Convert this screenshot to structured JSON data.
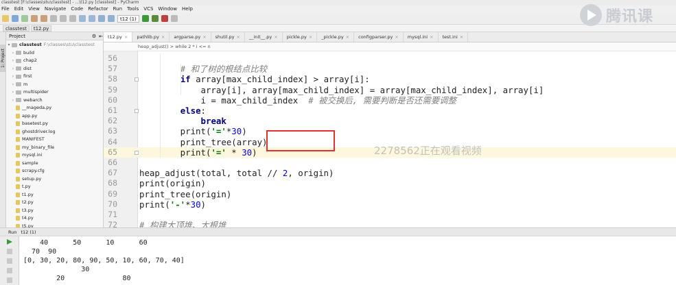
{
  "window": {
    "title": "classtest [F:\\classes\\stu\\classtest] - ...\\t12.py [classtest] - PyCharm"
  },
  "menu": [
    "File",
    "Edit",
    "View",
    "Navigate",
    "Code",
    "Refactor",
    "Run",
    "Tools",
    "VCS",
    "Window",
    "Help"
  ],
  "toolbar": {
    "run_config": "t12 (1)"
  },
  "breadcrumb": [
    "classtest",
    "t12.py"
  ],
  "project": {
    "header": "Project",
    "root_name": "classtest",
    "root_path": "F:\\classes\\stu\\classtest",
    "items": [
      {
        "label": "build",
        "type": "folder"
      },
      {
        "label": "chap2",
        "type": "folder"
      },
      {
        "label": "dist",
        "type": "folder"
      },
      {
        "label": "first",
        "type": "folder"
      },
      {
        "label": "m",
        "type": "folder"
      },
      {
        "label": "multispider",
        "type": "folder"
      },
      {
        "label": "webarch",
        "type": "folder"
      },
      {
        "label": "__mageda.py",
        "type": "file"
      },
      {
        "label": "app.py",
        "type": "file"
      },
      {
        "label": "basetest.py",
        "type": "file"
      },
      {
        "label": "ghostdriver.log",
        "type": "file"
      },
      {
        "label": "MANIFEST",
        "type": "file"
      },
      {
        "label": "my_binary_file",
        "type": "file"
      },
      {
        "label": "mysql.ini",
        "type": "file"
      },
      {
        "label": "sample",
        "type": "file"
      },
      {
        "label": "scrapy.cfg",
        "type": "file"
      },
      {
        "label": "setup.py",
        "type": "file"
      },
      {
        "label": "t.py",
        "type": "file"
      },
      {
        "label": "t1.py",
        "type": "file"
      },
      {
        "label": "t2.py",
        "type": "file"
      },
      {
        "label": "t3.py",
        "type": "file"
      },
      {
        "label": "t4.py",
        "type": "file"
      },
      {
        "label": "t5.py",
        "type": "file"
      }
    ]
  },
  "tabs": [
    "t12.py",
    "pathlib.py",
    "argparse.py",
    "shutil.py",
    "__init__.py",
    "pickle.py",
    "_pickle.py",
    "configparser.py",
    "mysql.ini",
    "test.ini"
  ],
  "editor_crumbs": "heap_adjust()  >  while 2 * i <= n",
  "code_lines": [
    {
      "n": "56",
      "t": ""
    },
    {
      "n": "57",
      "t": "        # 和了树的根结点比较"
    },
    {
      "n": "58",
      "t": "        if array[max_child_index] > array[i]:"
    },
    {
      "n": "59",
      "t": "            array[i], array[max_child_index] = array[max_child_index], array[i]"
    },
    {
      "n": "60",
      "t": "            i = max_child_index  # 被交换后, 需要判断是否还需要调整"
    },
    {
      "n": "61",
      "t": "        else:"
    },
    {
      "n": "62",
      "t": "            break"
    },
    {
      "n": "63",
      "t": "        print('='*30)"
    },
    {
      "n": "64",
      "t": "        print_tree(array)"
    },
    {
      "n": "65",
      "t": "        print('=' * 30)"
    },
    {
      "n": "66",
      "t": ""
    },
    {
      "n": "67",
      "t": "heap_adjust(total, total // 2, origin)"
    },
    {
      "n": "68",
      "t": "print(origin)"
    },
    {
      "n": "69",
      "t": "print_tree(origin)"
    },
    {
      "n": "70",
      "t": "print('-'*30)"
    },
    {
      "n": "71",
      "t": ""
    },
    {
      "n": "72",
      "t": "# 构建大顶堆、大根堆"
    }
  ],
  "watermark": "2278562正在观看视频",
  "logo": {
    "text": "腾讯课"
  },
  "run": {
    "label": "Run",
    "config": "t12 (1)"
  },
  "console_lines": [
    "    40      50      10      60",
    "  70  90",
    "[0, 30, 20, 80, 90, 50, 10, 60, 70, 40]",
    "              30",
    "        20              80"
  ]
}
